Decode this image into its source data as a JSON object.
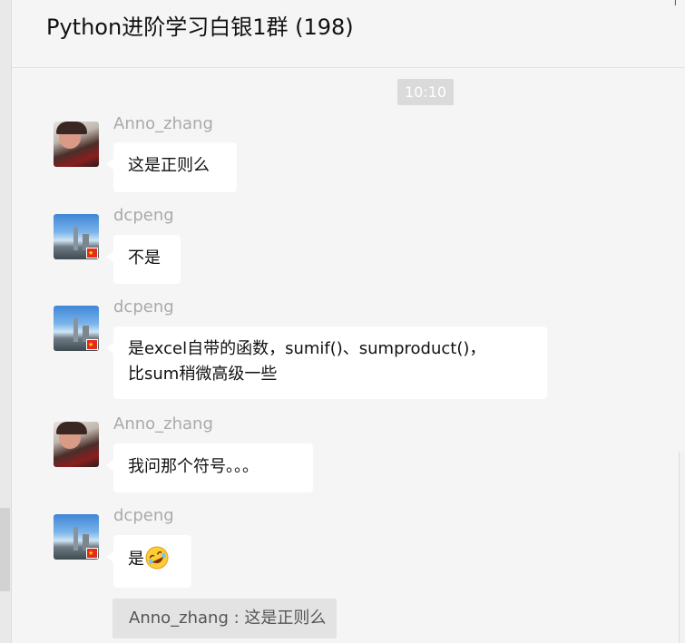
{
  "window": {
    "title": "Python进阶学习白银1群 (198)",
    "pin_glyph": "↑"
  },
  "timestamp": "10:10",
  "messages": [
    {
      "sender": "Anno_zhang",
      "avatar": "anno-avatar",
      "lines": [
        "这是正则么"
      ]
    },
    {
      "sender": "dcpeng",
      "avatar": "dcpeng-avatar",
      "lines": [
        "不是"
      ]
    },
    {
      "sender": "dcpeng",
      "avatar": "dcpeng-avatar",
      "lines": [
        "是excel自带的函数，sumif()、sumproduct()，",
        "比sum稍微高级一些"
      ]
    },
    {
      "sender": "Anno_zhang",
      "avatar": "anno-avatar",
      "lines": [
        "我问那个符号。。。"
      ]
    },
    {
      "sender": "dcpeng",
      "avatar": "dcpeng-avatar",
      "lines": [
        "是"
      ],
      "emoji": "rolling-on-floor-laughing-emoji"
    }
  ],
  "quote": {
    "text": "Anno_zhang : 这是正则么"
  },
  "colors": {
    "background": "#f5f5f5",
    "bubble": "#ffffff",
    "sender_name": "#aaaaaa",
    "timestamp_chip": "#dadada",
    "quote_bg": "#e3e3e3"
  }
}
